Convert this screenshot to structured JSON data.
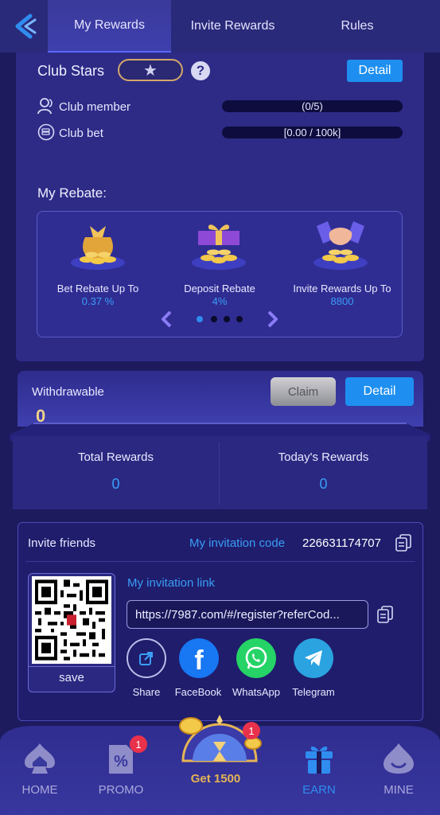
{
  "tabs": [
    {
      "label": "My Rewards",
      "active": true
    },
    {
      "label": "Invite Rewards",
      "active": false
    },
    {
      "label": "Rules",
      "active": false
    }
  ],
  "club": {
    "title": "Club Stars",
    "detail_label": "Detail",
    "member_label": "Club member",
    "member_value": "(0/5)",
    "bet_label": "Club bet",
    "bet_value": "[0.00 / 100k]"
  },
  "rebate": {
    "title": "My Rebate:",
    "items": [
      {
        "label": "Bet Rebate Up To",
        "value": "0.37 %"
      },
      {
        "label": "Deposit Rebate",
        "value": "4%"
      },
      {
        "label": "Invite Rewards Up To",
        "value": "8800"
      }
    ],
    "page_count": 4,
    "active_page": 1
  },
  "withdraw": {
    "label": "Withdrawable",
    "value": "0",
    "claim_label": "Claim",
    "detail_label": "Detail"
  },
  "stats": {
    "total_label": "Total Rewards",
    "total_value": "0",
    "today_label": "Today's Rewards",
    "today_value": "0"
  },
  "invite": {
    "title": "Invite friends",
    "code_label": "My invitation code",
    "code_value": "226631174707",
    "link_label": "My invitation link",
    "link_value": "https://7987.com/#/register?referCod...",
    "save_label": "save",
    "share": [
      {
        "label": "Share",
        "icon": "share-icon"
      },
      {
        "label": "FaceBook",
        "icon": "facebook-icon",
        "color": "#1877f2"
      },
      {
        "label": "WhatsApp",
        "icon": "whatsapp-icon",
        "color": "#25d366"
      },
      {
        "label": "Telegram",
        "icon": "telegram-icon",
        "color": "#2aa3e0"
      }
    ]
  },
  "nav": {
    "items": [
      {
        "label": "HOME"
      },
      {
        "label": "PROMO",
        "badge": "1"
      },
      {
        "label": "EARN",
        "active": true
      },
      {
        "label": "MINE"
      }
    ],
    "center_label": "Get 1500",
    "center_badge": "1"
  },
  "colors": {
    "accent": "#1e8ff0",
    "link_blue": "#3a9df6",
    "badge_red": "#e8314a",
    "gold": "#e5b454"
  }
}
